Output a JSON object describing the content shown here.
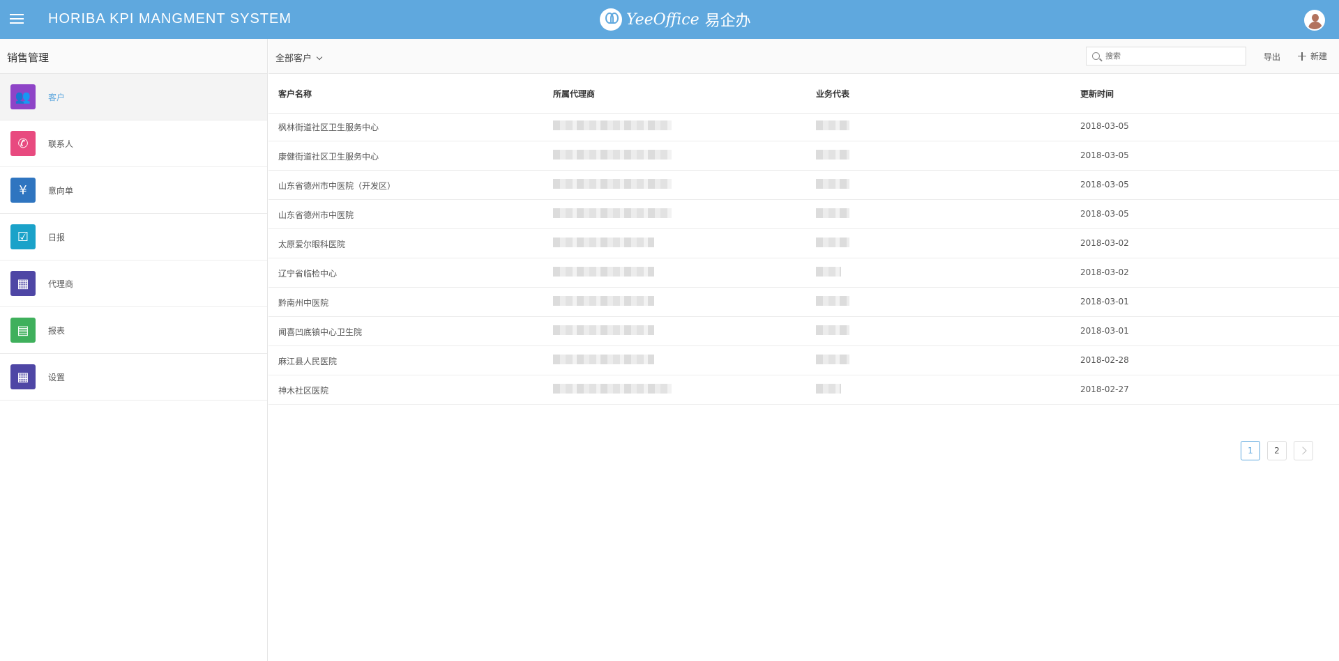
{
  "header": {
    "app_title": "HORIBA KPI MANGMENT SYSTEM",
    "brand_latin": "YeeOffice",
    "brand_cn": "易企办"
  },
  "sidebar": {
    "title": "销售管理",
    "items": [
      {
        "label": "客户",
        "icon": "users-icon",
        "color": "#8e44c7",
        "glyph": "👥"
      },
      {
        "label": "联系人",
        "icon": "contact-card-icon",
        "color": "#e84a7f",
        "glyph": "✆"
      },
      {
        "label": "意向单",
        "icon": "yen-icon",
        "color": "#2f75c0",
        "glyph": "¥"
      },
      {
        "label": "日报",
        "icon": "daily-report-icon",
        "color": "#1aa2c9",
        "glyph": "☑"
      },
      {
        "label": "代理商",
        "icon": "agent-grid-icon",
        "color": "#4e46a5",
        "glyph": "▦"
      },
      {
        "label": "报表",
        "icon": "report-search-icon",
        "color": "#3fb05c",
        "glyph": "▤"
      },
      {
        "label": "设置",
        "icon": "settings-grid-icon",
        "color": "#4e46a5",
        "glyph": "▦"
      }
    ]
  },
  "toolbar": {
    "filter_label": "全部客户",
    "search_placeholder": "搜索",
    "export_label": "导出",
    "new_label": "新建"
  },
  "table": {
    "columns": [
      "客户名称",
      "所属代理商",
      "业务代表",
      "更新时间"
    ],
    "rows": [
      {
        "name": "枫林街道社区卫生服务中心",
        "date": "2018-03-05"
      },
      {
        "name": "康健街道社区卫生服务中心",
        "date": "2018-03-05"
      },
      {
        "name": "山东省德州市中医院（开发区）",
        "date": "2018-03-05"
      },
      {
        "name": "山东省德州市中医院",
        "date": "2018-03-05"
      },
      {
        "name": "太原爱尔眼科医院",
        "date": "2018-03-02"
      },
      {
        "name": "辽宁省临检中心",
        "date": "2018-03-02"
      },
      {
        "name": "黔南州中医院",
        "date": "2018-03-01"
      },
      {
        "name": "闻喜凹底镇中心卫生院",
        "date": "2018-03-01"
      },
      {
        "name": "麻江县人民医院",
        "date": "2018-02-28"
      },
      {
        "name": "神木社区医院",
        "date": "2018-02-27"
      }
    ]
  },
  "pagination": {
    "pages": [
      "1",
      "2"
    ],
    "current": "1"
  },
  "colors": {
    "header_bg": "#5fa8de",
    "accent": "#5fa8de"
  }
}
